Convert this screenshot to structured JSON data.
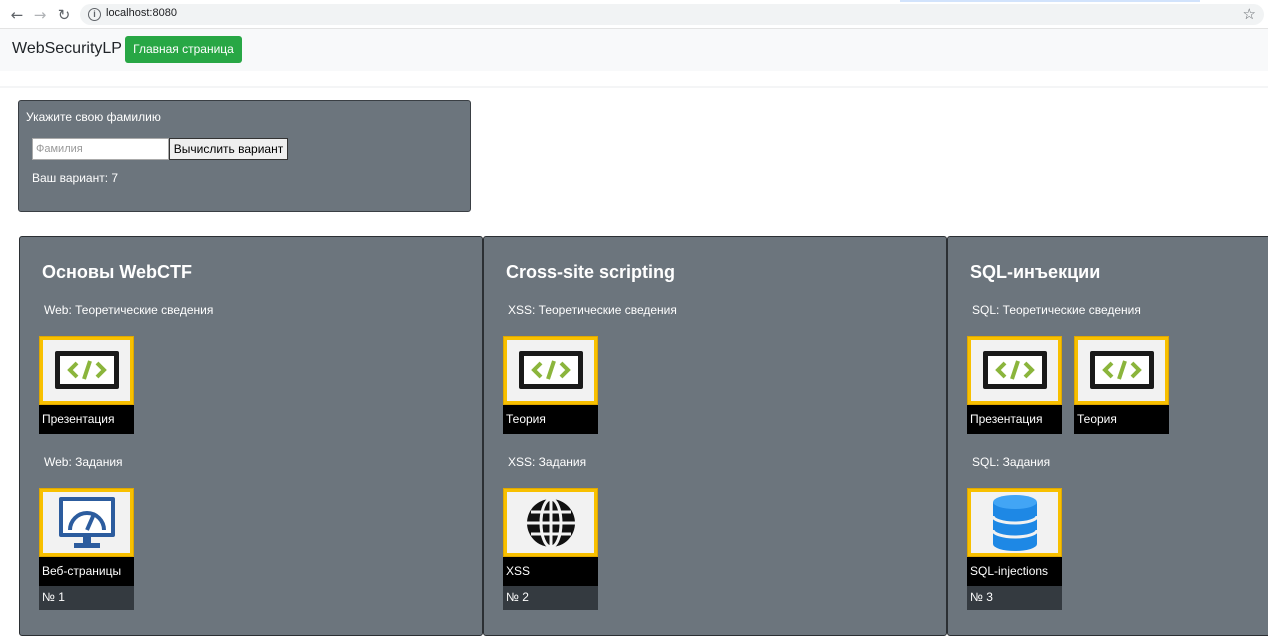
{
  "browser": {
    "url": "localhost:8080"
  },
  "navbar": {
    "brand": "WebSecurityLP",
    "home_button": "Главная страница"
  },
  "variant_form": {
    "title": "Укажите свою фамилию",
    "input_placeholder": "Фамилия",
    "button_label": "Вычислить вариант",
    "result": "Ваш вариант: 7"
  },
  "modules": [
    {
      "title": "Основы WebCTF",
      "theory_label": "Web: Теоретические сведения",
      "theory_items": [
        {
          "caption": "Презентация",
          "icon": "code-monitor-icon"
        }
      ],
      "tasks_label": "Web: Задания",
      "tasks": [
        {
          "caption": "Веб-страницы",
          "number": "№ 1",
          "icon": "web-monitor-icon"
        }
      ]
    },
    {
      "title": "Cross-site scripting",
      "theory_label": "XSS: Теоретические сведения",
      "theory_items": [
        {
          "caption": "Теория",
          "icon": "code-monitor-icon"
        }
      ],
      "tasks_label": "XSS: Задания",
      "tasks": [
        {
          "caption": "XSS",
          "number": "№ 2",
          "icon": "globe-icon"
        }
      ]
    },
    {
      "title": "SQL-инъекции",
      "theory_label": "SQL: Теоретические сведения",
      "theory_items": [
        {
          "caption": "Презентация",
          "icon": "code-monitor-icon"
        },
        {
          "caption": "Теория",
          "icon": "code-monitor-icon"
        }
      ],
      "tasks_label": "SQL: Задания",
      "tasks": [
        {
          "caption": "SQL-injections",
          "number": "№ 3",
          "icon": "database-icon"
        }
      ]
    }
  ],
  "colors": {
    "card_bg": "#6c757d",
    "tile_border": "#f8c000",
    "home_button": "#28a745"
  }
}
